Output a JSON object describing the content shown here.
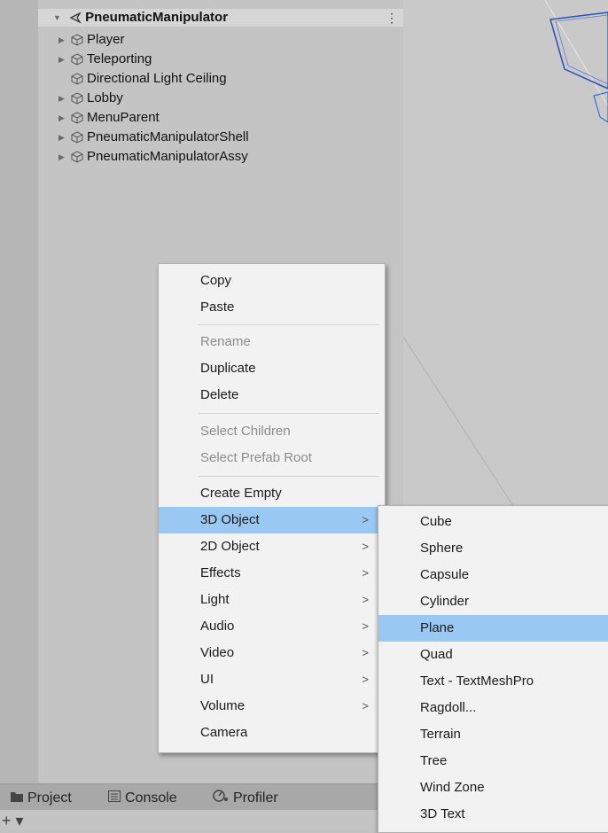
{
  "hierarchy": {
    "scene_name": "PneumaticManipulator",
    "items": [
      {
        "label": "Player",
        "expandable": true
      },
      {
        "label": "Teleporting",
        "expandable": true
      },
      {
        "label": "Directional Light Ceiling",
        "expandable": false
      },
      {
        "label": "Lobby",
        "expandable": true
      },
      {
        "label": "MenuParent",
        "expandable": true
      },
      {
        "label": "PneumaticManipulatorShell",
        "expandable": true
      },
      {
        "label": "PneumaticManipulatorAssy",
        "expandable": true
      }
    ]
  },
  "context_menu": {
    "copy": "Copy",
    "paste": "Paste",
    "rename": "Rename",
    "duplicate": "Duplicate",
    "delete": "Delete",
    "select_children": "Select Children",
    "select_prefab_root": "Select Prefab Root",
    "create_empty": "Create Empty",
    "object_3d": "3D Object",
    "object_2d": "2D Object",
    "effects": "Effects",
    "light": "Light",
    "audio": "Audio",
    "video": "Video",
    "ui": "UI",
    "volume": "Volume",
    "camera": "Camera",
    "submenu_arrow": ">"
  },
  "submenu_3d": {
    "items": [
      "Cube",
      "Sphere",
      "Capsule",
      "Cylinder",
      "Plane",
      "Quad",
      "Text - TextMeshPro",
      "Ragdoll...",
      "Terrain",
      "Tree",
      "Wind Zone",
      "3D Text"
    ],
    "highlighted": "Plane"
  },
  "bottom_tabs": {
    "project": "Project",
    "console": "Console",
    "profiler": "Profiler",
    "add": "+ ▾"
  },
  "colors": {
    "highlight": "#99c9f3",
    "menu_bg": "#f2f2f2",
    "panel_bg": "#c4c4c4",
    "gizmo_blue": "#2a4fb8"
  },
  "icons": {
    "scene": "unity-scene-icon",
    "gameobject": "cube-icon",
    "expand": "triangle-right-icon",
    "project": "folder-icon",
    "console": "console-icon",
    "profiler": "profiler-icon"
  }
}
